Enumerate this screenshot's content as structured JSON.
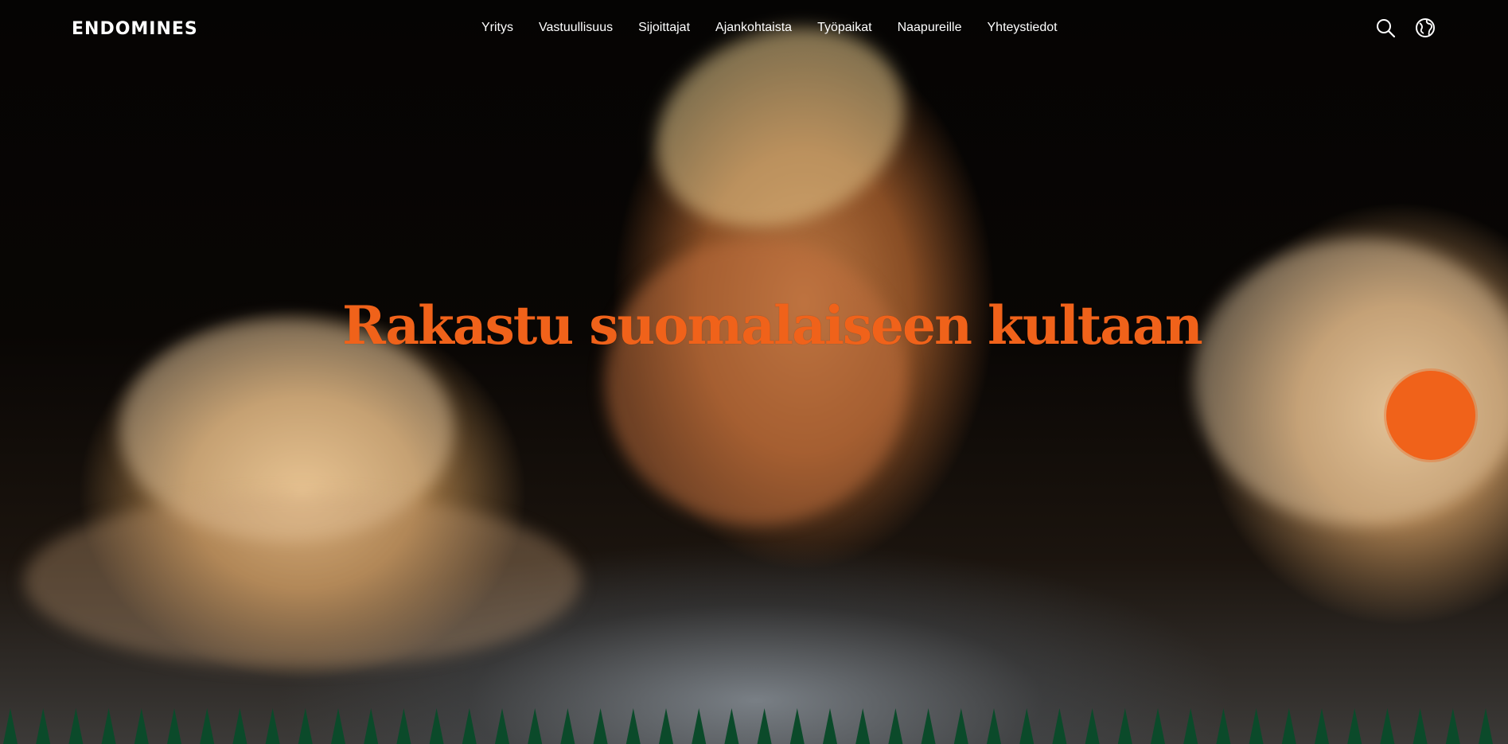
{
  "header": {
    "logo_text": "ENDOMINES",
    "nav": [
      {
        "label": "Yritys"
      },
      {
        "label": "Vastuullisuus"
      },
      {
        "label": "Sijoittajat"
      },
      {
        "label": "Ajankohtaista"
      },
      {
        "label": "Työpaikat"
      },
      {
        "label": "Naapureille"
      },
      {
        "label": "Yhteystiedot"
      }
    ],
    "icons": [
      "search-icon",
      "globe-icon"
    ]
  },
  "hero": {
    "headline": "Rakastu suomalaiseen kultaan"
  },
  "colors": {
    "accent": "#f0621a",
    "spikes": "#0b4a2a",
    "nav_text": "#ffffff"
  }
}
